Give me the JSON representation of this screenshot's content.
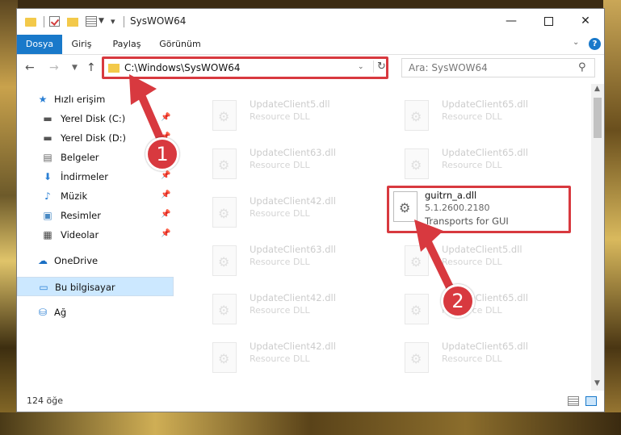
{
  "window": {
    "title": "SysWOW64"
  },
  "titlebar": {
    "minimize_glyph": "—",
    "close_glyph": "✕"
  },
  "ribbon": {
    "tabs": [
      "Dosya",
      "Giriş",
      "Paylaş",
      "Görünüm"
    ],
    "help_glyph": "?"
  },
  "address": {
    "path": "C:\\Windows\\SysWOW64",
    "refresh_glyph": "↻"
  },
  "search": {
    "placeholder": "Ara: SysWOW64"
  },
  "nav": {
    "quick_access": "Hızlı erişim",
    "items": [
      {
        "label": "Yerel Disk (C:)",
        "icon": "drive-icon"
      },
      {
        "label": "Yerel Disk (D:)",
        "icon": "drive-icon"
      },
      {
        "label": "Belgeler",
        "icon": "documents-icon"
      },
      {
        "label": "İndirmeler",
        "icon": "download-icon"
      },
      {
        "label": "Müzik",
        "icon": "music-icon"
      },
      {
        "label": "Resimler",
        "icon": "pictures-icon"
      },
      {
        "label": "Videolar",
        "icon": "videos-icon"
      }
    ],
    "onedrive": "OneDrive",
    "this_pc": "Bu bilgisayar",
    "network": "Ağ"
  },
  "files": {
    "left_column": [
      {
        "name": "UpdateClient5.dll",
        "desc": "Resource DLL"
      },
      {
        "name": "UpdateClient63.dll",
        "desc": "Resource DLL"
      },
      {
        "name": "UpdateClient42.dll",
        "desc": "Resource DLL"
      },
      {
        "name": "UpdateClient63.dll",
        "desc": "Resource DLL"
      },
      {
        "name": "UpdateClient42.dll",
        "desc": "Resource DLL"
      },
      {
        "name": "UpdateClient42.dll",
        "desc": "Resource DLL"
      }
    ],
    "right_column": [
      {
        "name": "UpdateClient65.dll",
        "desc": "Resource DLL"
      },
      {
        "name": "UpdateClient65.dll",
        "desc": "Resource DLL"
      },
      {
        "name": "UpdateClient5.dll",
        "desc": "Resource DLL"
      },
      {
        "name": "UpdateClient65.dll",
        "desc": "Resource DLL"
      },
      {
        "name": "UpdateClient65.dll",
        "desc": "Resource DLL"
      }
    ],
    "highlighted": {
      "name": "guitrn_a.dll",
      "version": "5.1.2600.2180",
      "desc": "Transports for GUI"
    }
  },
  "status": {
    "count": "124 öğe"
  },
  "annotations": {
    "badge1": "1",
    "badge2": "2",
    "color": "#d8393f"
  }
}
